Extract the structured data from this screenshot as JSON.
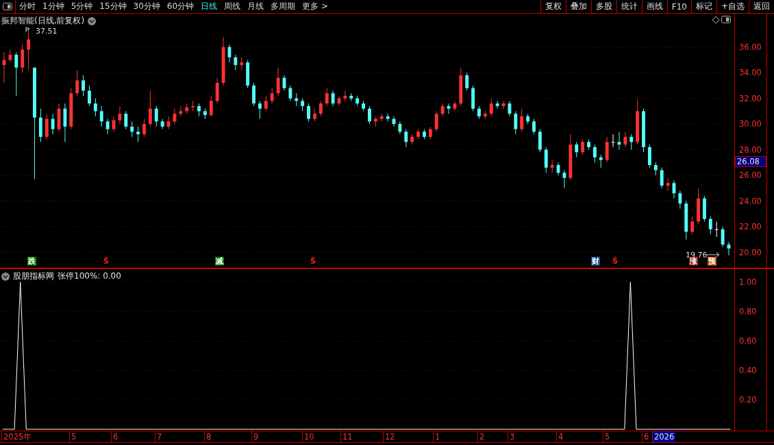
{
  "toolbar": {
    "tabs": [
      {
        "label": "分时",
        "selected": false
      },
      {
        "label": "1分钟",
        "selected": false
      },
      {
        "label": "5分钟",
        "selected": false
      },
      {
        "label": "15分钟",
        "selected": false
      },
      {
        "label": "30分钟",
        "selected": false
      },
      {
        "label": "60分钟",
        "selected": false
      },
      {
        "label": "日线",
        "selected": true
      },
      {
        "label": "周线",
        "selected": false
      },
      {
        "label": "月线",
        "selected": false
      },
      {
        "label": "多周期",
        "selected": false
      },
      {
        "label": "更多 >",
        "selected": false
      }
    ],
    "buttons": [
      "复权",
      "叠加",
      "多股",
      "统计",
      "画线",
      "F10",
      "标记",
      "+自选",
      "返回"
    ]
  },
  "price_panel": {
    "title": "振邦智能(日线,前复权)",
    "high_label": "37.51",
    "low_label": "19.76",
    "current_price": "26.08",
    "chart_data": {
      "type": "candlestick",
      "grid": true,
      "ylim": [
        18.8,
        38.6
      ],
      "yticks": [
        {
          "value": 36,
          "label": "36.00"
        },
        {
          "value": 34,
          "label": "34.00"
        },
        {
          "value": 32,
          "label": "32.00"
        },
        {
          "value": 30,
          "label": "30.00"
        },
        {
          "value": 28,
          "label": "28.00"
        },
        {
          "value": 26,
          "label": "26.00"
        },
        {
          "value": 24,
          "label": "24.00"
        },
        {
          "value": 22,
          "label": "22.00"
        },
        {
          "value": 20,
          "label": "20.00"
        }
      ],
      "ohlc": [
        [
          34.6,
          35.6,
          33.2,
          35.0
        ],
        [
          35.0,
          35.8,
          34.8,
          35.4
        ],
        [
          35.4,
          35.6,
          32.2,
          34.4
        ],
        [
          34.4,
          36.2,
          34.0,
          35.8
        ],
        [
          35.8,
          37.51,
          34.2,
          36.6
        ],
        [
          34.4,
          34.4,
          25.7,
          30.5
        ],
        [
          30.5,
          31.2,
          28.6,
          29.0
        ],
        [
          29.0,
          30.8,
          28.8,
          30.4
        ],
        [
          30.4,
          30.8,
          29.2,
          29.6
        ],
        [
          29.6,
          31.6,
          29.4,
          31.2
        ],
        [
          31.2,
          31.6,
          28.6,
          29.8
        ],
        [
          29.8,
          32.8,
          29.6,
          32.4
        ],
        [
          32.4,
          34.2,
          32.2,
          33.4
        ],
        [
          33.4,
          33.8,
          32.2,
          32.6
        ],
        [
          32.6,
          33.0,
          31.4,
          31.6
        ],
        [
          31.6,
          32.0,
          30.6,
          31.0
        ],
        [
          31.0,
          31.4,
          29.8,
          30.2
        ],
        [
          30.2,
          30.4,
          29.2,
          29.6
        ],
        [
          29.6,
          30.6,
          29.4,
          30.3
        ],
        [
          30.3,
          31.4,
          30.0,
          30.8
        ],
        [
          30.8,
          31.0,
          29.6,
          29.8
        ],
        [
          29.8,
          30.2,
          29.0,
          29.4
        ],
        [
          29.4,
          29.8,
          28.6,
          29.2
        ],
        [
          29.2,
          30.4,
          29.0,
          30.0
        ],
        [
          30.0,
          32.6,
          29.8,
          31.2
        ],
        [
          31.2,
          31.4,
          29.8,
          30.2
        ],
        [
          30.2,
          30.4,
          29.6,
          29.8
        ],
        [
          29.8,
          30.6,
          29.6,
          30.2
        ],
        [
          30.2,
          31.2,
          30.0,
          30.8
        ],
        [
          30.8,
          31.4,
          30.6,
          31.0
        ],
        [
          31.0,
          31.6,
          30.8,
          31.3
        ],
        [
          31.3,
          31.8,
          31.0,
          31.4
        ],
        [
          31.4,
          31.6,
          30.6,
          31.0
        ],
        [
          31.0,
          31.2,
          30.4,
          30.7
        ],
        [
          30.7,
          32.2,
          30.6,
          31.8
        ],
        [
          31.8,
          33.6,
          31.6,
          33.2
        ],
        [
          33.2,
          36.8,
          33.0,
          36.0
        ],
        [
          36.0,
          36.2,
          34.8,
          35.2
        ],
        [
          35.2,
          35.4,
          34.2,
          34.6
        ],
        [
          34.6,
          35.2,
          34.2,
          34.8
        ],
        [
          34.8,
          35.0,
          32.8,
          33.0
        ],
        [
          33.0,
          33.2,
          31.4,
          31.6
        ],
        [
          31.6,
          31.8,
          30.4,
          31.2
        ],
        [
          31.2,
          32.2,
          31.0,
          31.8
        ],
        [
          31.8,
          32.8,
          31.6,
          32.4
        ],
        [
          32.4,
          34.4,
          32.2,
          33.6
        ],
        [
          33.6,
          33.8,
          32.6,
          32.8
        ],
        [
          32.8,
          33.0,
          31.8,
          32.0
        ],
        [
          32.0,
          32.4,
          31.4,
          31.8
        ],
        [
          31.8,
          32.0,
          31.0,
          31.4
        ],
        [
          31.4,
          31.6,
          30.2,
          30.4
        ],
        [
          30.4,
          31.2,
          30.2,
          30.8
        ],
        [
          30.8,
          31.8,
          30.6,
          31.6
        ],
        [
          31.6,
          32.8,
          31.4,
          32.4
        ],
        [
          32.4,
          32.6,
          31.4,
          31.6
        ],
        [
          31.6,
          32.2,
          31.4,
          32.0
        ],
        [
          32.0,
          32.6,
          31.8,
          32.2
        ],
        [
          32.2,
          32.4,
          31.8,
          32.0
        ],
        [
          32.0,
          32.2,
          31.4,
          31.6
        ],
        [
          31.6,
          31.8,
          31.0,
          31.2
        ],
        [
          31.2,
          31.4,
          30.0,
          30.2
        ],
        [
          30.2,
          30.6,
          29.8,
          30.4
        ],
        [
          30.4,
          30.8,
          30.2,
          30.6
        ],
        [
          30.6,
          30.8,
          30.2,
          30.4
        ],
        [
          30.4,
          30.6,
          29.8,
          30.0
        ],
        [
          30.0,
          30.2,
          29.2,
          29.4
        ],
        [
          29.4,
          29.6,
          28.2,
          28.6
        ],
        [
          28.6,
          29.2,
          28.4,
          29.0
        ],
        [
          29.0,
          29.6,
          28.8,
          29.4
        ],
        [
          29.4,
          29.6,
          28.8,
          29.0
        ],
        [
          29.0,
          29.8,
          28.8,
          29.6
        ],
        [
          29.6,
          31.0,
          29.4,
          30.8
        ],
        [
          30.8,
          31.6,
          30.6,
          31.4
        ],
        [
          31.4,
          31.6,
          30.8,
          31.2
        ],
        [
          31.2,
          31.8,
          31.0,
          31.6
        ],
        [
          31.6,
          34.4,
          31.4,
          33.8
        ],
        [
          33.8,
          34.0,
          32.6,
          32.8
        ],
        [
          32.8,
          33.0,
          31.0,
          31.2
        ],
        [
          31.2,
          31.4,
          30.4,
          30.6
        ],
        [
          30.6,
          31.0,
          30.4,
          30.8
        ],
        [
          30.8,
          32.0,
          30.6,
          31.6
        ],
        [
          31.6,
          31.8,
          31.2,
          31.4
        ],
        [
          31.4,
          31.8,
          31.2,
          31.6
        ],
        [
          31.6,
          31.8,
          30.6,
          30.8
        ],
        [
          30.8,
          31.0,
          29.2,
          29.6
        ],
        [
          29.6,
          31.2,
          29.4,
          30.6
        ],
        [
          30.6,
          30.8,
          30.0,
          30.2
        ],
        [
          30.2,
          30.4,
          29.2,
          29.4
        ],
        [
          29.4,
          29.6,
          27.8,
          28.0
        ],
        [
          28.0,
          28.2,
          26.2,
          26.6
        ],
        [
          26.6,
          27.2,
          26.2,
          26.8
        ],
        [
          26.8,
          27.0,
          26.0,
          26.2
        ],
        [
          26.2,
          26.4,
          25.0,
          25.8
        ],
        [
          25.8,
          29.2,
          25.6,
          28.4
        ],
        [
          28.4,
          28.6,
          27.4,
          27.8
        ],
        [
          27.8,
          28.8,
          27.6,
          28.6
        ],
        [
          28.6,
          28.8,
          28.0,
          28.2
        ],
        [
          28.2,
          28.4,
          27.0,
          27.4
        ],
        [
          27.4,
          27.6,
          26.6,
          27.2
        ],
        [
          27.2,
          29.0,
          27.0,
          28.6
        ],
        [
          28.6,
          29.2,
          28.2,
          28.6
        ],
        [
          28.6,
          29.4,
          28.0,
          28.4
        ],
        [
          28.4,
          29.4,
          28.2,
          29.0
        ],
        [
          29.0,
          29.2,
          28.0,
          28.6
        ],
        [
          28.6,
          31.9,
          28.4,
          31.0
        ],
        [
          31.0,
          31.2,
          27.8,
          28.2
        ],
        [
          28.2,
          28.4,
          26.6,
          26.8
        ],
        [
          26.8,
          27.0,
          26.0,
          26.4
        ],
        [
          26.4,
          26.6,
          25.0,
          25.2
        ],
        [
          25.2,
          25.8,
          24.8,
          25.4
        ],
        [
          25.4,
          25.6,
          24.2,
          24.6
        ],
        [
          24.6,
          24.8,
          23.4,
          23.8
        ],
        [
          23.8,
          24.0,
          21.0,
          21.6
        ],
        [
          21.6,
          22.8,
          21.4,
          22.4
        ],
        [
          22.4,
          25.0,
          22.2,
          24.2
        ],
        [
          24.2,
          24.4,
          22.4,
          22.6
        ],
        [
          22.6,
          22.8,
          21.4,
          21.8
        ],
        [
          21.8,
          22.4,
          21.2,
          21.8
        ],
        [
          21.8,
          22.0,
          20.4,
          20.6
        ],
        [
          20.6,
          20.8,
          19.76,
          20.3
        ]
      ]
    },
    "markers": [
      {
        "text": "跌",
        "kind": "tag",
        "color": "#0a7a0a"
      },
      {
        "text": "Ŝ",
        "kind": "signal",
        "color": "#ff2020"
      },
      {
        "text": "减",
        "kind": "tag",
        "color": "#0a7a0a"
      },
      {
        "text": "Ŝ",
        "kind": "signal",
        "color": "#ff2020"
      },
      {
        "text": "财",
        "kind": "tag",
        "color": "#1a4a8a"
      },
      {
        "text": "Ŝ",
        "kind": "signal",
        "color": "#ff2020"
      },
      {
        "text": "涨",
        "kind": "tag",
        "color": "#8a1a1a"
      },
      {
        "text": "预",
        "kind": "tag",
        "color": "#c0500a"
      }
    ]
  },
  "indicator_panel": {
    "name": "股朋指标网",
    "legend": "张停100%: 0.00",
    "chart_data": {
      "type": "line",
      "grid": true,
      "ylim": [
        0,
        1
      ],
      "yticks": [
        {
          "value": 1,
          "label": "1.00"
        },
        {
          "value": 0.8,
          "label": "0.80"
        },
        {
          "value": 0.6,
          "label": "0.60"
        },
        {
          "value": 0.4,
          "label": "0.40"
        },
        {
          "value": 0.2,
          "label": "0.20"
        }
      ],
      "series": [
        {
          "color": "#ffffff",
          "values": [
            0,
            0,
            0,
            1,
            0,
            0,
            0,
            0,
            0,
            0,
            0,
            0,
            0,
            0,
            0,
            0,
            0,
            0,
            0,
            0,
            0,
            0,
            0,
            0,
            0,
            0,
            0,
            0,
            0,
            0,
            0,
            0,
            0,
            0,
            0,
            0,
            0,
            0,
            0,
            0,
            0,
            0,
            0,
            0,
            0,
            0,
            0,
            0,
            0,
            0,
            0,
            0,
            0,
            0,
            0,
            0,
            0,
            0,
            0,
            0,
            0,
            0,
            0,
            0,
            0,
            0,
            0,
            0,
            0,
            0,
            0,
            0,
            0,
            0,
            0,
            0,
            0,
            0,
            0,
            0,
            0,
            0,
            0,
            0,
            0,
            0,
            0,
            0,
            0,
            0,
            0,
            0,
            0,
            0,
            0,
            0,
            0,
            0,
            0,
            0,
            0,
            0,
            0,
            0,
            0,
            0,
            0,
            1,
            0,
            0,
            0,
            0,
            0,
            0,
            0,
            0,
            0,
            0,
            0,
            0,
            0,
            0,
            0,
            0,
            0
          ]
        }
      ]
    }
  },
  "date_axis": {
    "labels": [
      {
        "text": "2025年",
        "highlighted": false
      },
      {
        "text": "5",
        "highlighted": false
      },
      {
        "text": "6",
        "highlighted": false
      },
      {
        "text": "7",
        "highlighted": false
      },
      {
        "text": "8",
        "highlighted": false
      },
      {
        "text": "9",
        "highlighted": false
      },
      {
        "text": "10",
        "highlighted": false
      },
      {
        "text": "11",
        "highlighted": false
      },
      {
        "text": "12",
        "highlighted": false
      },
      {
        "text": "1",
        "highlighted": false
      },
      {
        "text": "2",
        "highlighted": false
      },
      {
        "text": "3",
        "highlighted": false
      },
      {
        "text": "4",
        "highlighted": false
      },
      {
        "text": "5",
        "highlighted": false
      },
      {
        "text": "6",
        "highlighted": false
      },
      {
        "text": "2026",
        "highlighted": true
      }
    ]
  }
}
